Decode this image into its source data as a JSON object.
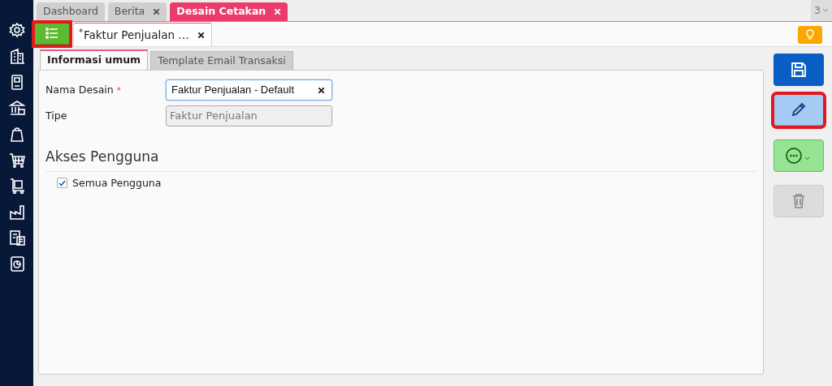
{
  "top_tabs": [
    {
      "label": "Dashboard",
      "closable": false,
      "selected": false
    },
    {
      "label": "Berita",
      "closable": true,
      "selected": false
    },
    {
      "label": "Desain Cetakan",
      "closable": true,
      "selected": true
    }
  ],
  "tab_count": "3",
  "menu_button": {
    "highlighted": true
  },
  "doc_tabs": [
    {
      "label": "Faktur Penjualan …",
      "modified_mark": "*",
      "selected": true
    }
  ],
  "section_tabs": [
    {
      "label": "Informasi umum",
      "selected": true
    },
    {
      "label": "Template Email Transaksi",
      "selected": false
    }
  ],
  "fields": [
    {
      "label": "Nama Desain",
      "required_mark": "*",
      "value": "Faktur Penjualan - Default",
      "disabled": false
    },
    {
      "label": "Tipe",
      "value": "Faktur Penjualan",
      "disabled": true
    }
  ],
  "access": {
    "title": "Akses Pengguna",
    "options": [
      {
        "label": "Semua Pengguna",
        "checked": true
      }
    ]
  },
  "actions": [
    {
      "kind": "save",
      "highlighted": false
    },
    {
      "kind": "edit",
      "highlighted": true
    },
    {
      "kind": "more",
      "highlighted": false
    },
    {
      "kind": "delete",
      "highlighted": false
    }
  ]
}
